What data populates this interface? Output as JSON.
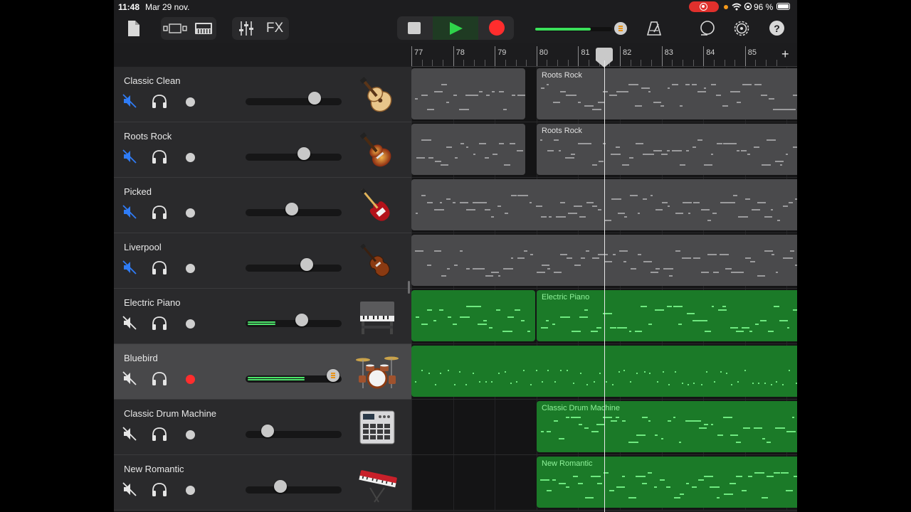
{
  "status_bar": {
    "time": "11:48",
    "date": "Mar 29 nov.",
    "battery_percent": "96 %",
    "battery_level": 0.96,
    "icons": [
      "record-indicator-icon",
      "wifi-icon",
      "orientation-lock-icon",
      "battery-icon"
    ]
  },
  "toolbar": {
    "left_icons": [
      "document-icon",
      "track-view-icon",
      "keyboard-view-icon",
      "mixer-icon"
    ],
    "fx_label": "FX",
    "transport": {
      "stop": "stop-icon",
      "play": "play-icon",
      "record": "record-icon"
    },
    "master_volume_level": 0.72,
    "right_icons": [
      "metronome-icon",
      "loop-browser-icon",
      "settings-icon",
      "help-icon"
    ],
    "help_label": "?"
  },
  "colors": {
    "accent": "#2fd34a",
    "record": "#ff2d2d",
    "region_green": "#1b7a28",
    "region_gray": "#4a4a4c",
    "mute_active": "#2f7cf6"
  },
  "ruler": {
    "bars": [
      "77",
      "78",
      "79",
      "80",
      "81",
      "82",
      "83",
      "84",
      "85"
    ],
    "add_label": "+"
  },
  "tracks": [
    {
      "name": "Classic Clean",
      "muted": true,
      "armed": false,
      "volume": 0.73,
      "meter": 0,
      "icon": "hollow-body-guitar-icon"
    },
    {
      "name": "Roots Rock",
      "muted": true,
      "armed": false,
      "volume": 0.61,
      "meter": 0,
      "icon": "sunburst-electric-guitar-icon"
    },
    {
      "name": "Picked",
      "muted": true,
      "armed": false,
      "volume": 0.48,
      "meter": 0,
      "icon": "red-bass-guitar-icon"
    },
    {
      "name": "Liverpool",
      "muted": true,
      "armed": false,
      "volume": 0.64,
      "meter": 0,
      "icon": "violin-bass-icon"
    },
    {
      "name": "Electric Piano",
      "muted": false,
      "armed": false,
      "volume": 0.59,
      "meter": 0.3,
      "icon": "electric-piano-icon"
    },
    {
      "name": "Bluebird",
      "muted": false,
      "armed": true,
      "volume": 0.93,
      "meter": 0.62,
      "icon": "drum-kit-icon"
    },
    {
      "name": "Classic Drum Machine",
      "muted": false,
      "armed": false,
      "volume": 0.22,
      "meter": 0,
      "icon": "drum-machine-icon"
    },
    {
      "name": "New Romantic",
      "muted": false,
      "armed": false,
      "volume": 0.36,
      "meter": 0,
      "icon": "synth-keyboard-icon"
    }
  ],
  "regions": {
    "roots_rock_1": "Roots Rock",
    "roots_rock_2": "Roots Rock",
    "electric_piano": "Electric Piano",
    "classic_drum_machine": "Classic Drum Machine",
    "new_romantic": "New Romantic"
  }
}
